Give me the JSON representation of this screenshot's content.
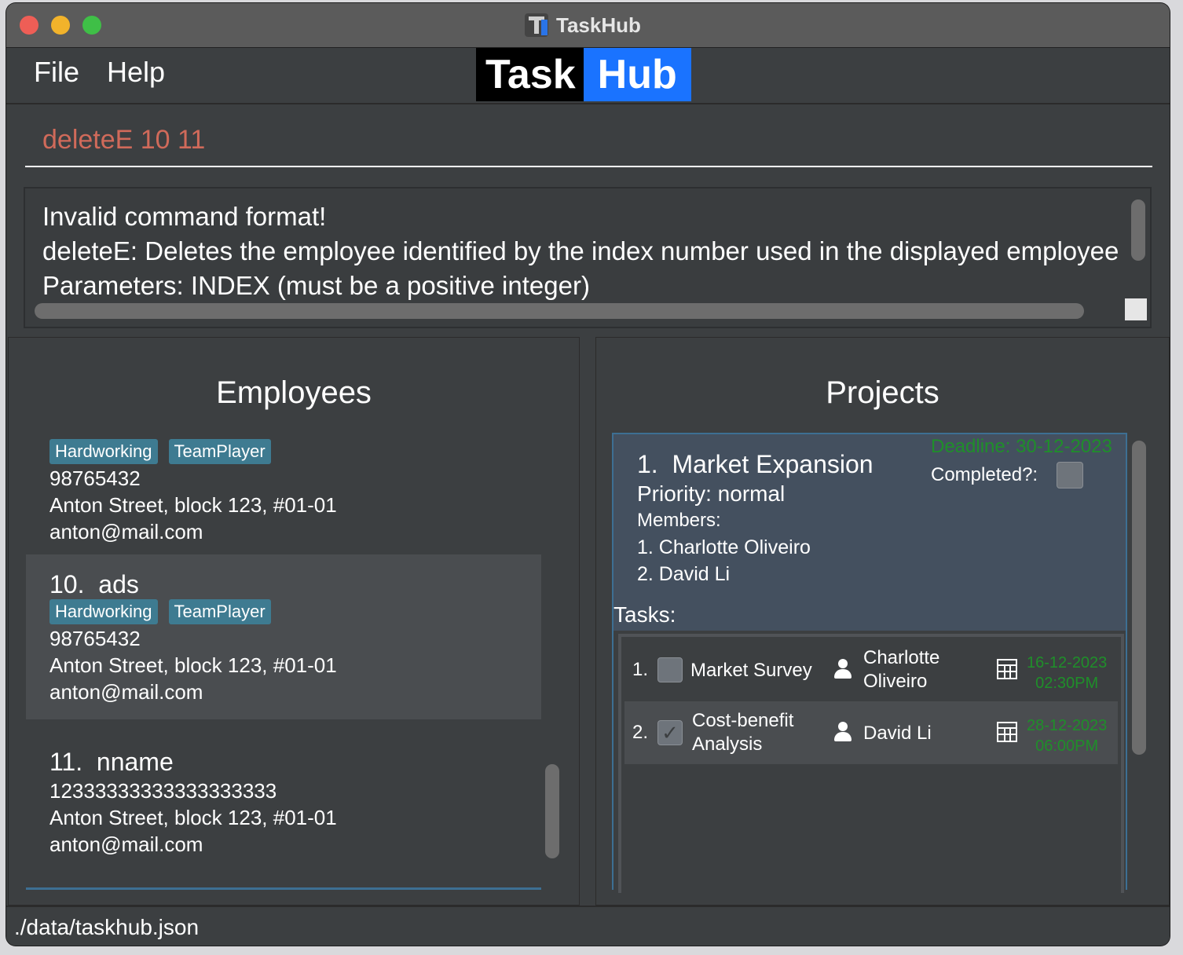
{
  "window": {
    "title": "TaskHub"
  },
  "menu": {
    "file": "File",
    "help": "Help"
  },
  "logo": {
    "part1": "Task",
    "part2": "Hub"
  },
  "command": {
    "value": "deleteE 10 11"
  },
  "result": {
    "line1": "Invalid command format!",
    "line2": "deleteE: Deletes the employee identified by the index number used in the displayed employee lis",
    "line3": "Parameters: INDEX (must be a positive integer)"
  },
  "employees": {
    "title": "Employees",
    "cards": [
      {
        "tags": [
          "Hardworking",
          "TeamPlayer"
        ],
        "phone": "98765432",
        "address": "Anton Street, block 123, #01-01",
        "email": "anton@mail.com"
      },
      {
        "index": "10.",
        "name": "ads",
        "tags": [
          "Hardworking",
          "TeamPlayer"
        ],
        "phone": "98765432",
        "address": "Anton Street, block 123, #01-01",
        "email": "anton@mail.com"
      },
      {
        "index": "11.",
        "name": "nname",
        "phone": "12333333333333333333",
        "address": "Anton Street, block 123, #01-01",
        "email": "anton@mail.com"
      }
    ]
  },
  "projects": {
    "title": "Projects",
    "card": {
      "index": "1.",
      "name": "Market Expansion",
      "priority": "Priority: normal",
      "members_label": "Members:",
      "members": [
        "1. Charlotte Oliveiro",
        "2. David Li"
      ],
      "deadline": "Deadline: 30-12-2023",
      "completed_label": "Completed?:",
      "tasks_label": "Tasks:",
      "tasks": [
        {
          "num": "1.",
          "name1": "Market Survey",
          "name2": "",
          "assignee1": "Charlotte",
          "assignee2": "Oliveiro",
          "date": "16-12-2023",
          "time": "02:30PM",
          "done": false
        },
        {
          "num": "2.",
          "name1": "Cost-benefit",
          "name2": "Analysis",
          "assignee1": "David Li",
          "assignee2": "",
          "date": "28-12-2023",
          "time": "06:00PM",
          "done": true
        }
      ]
    }
  },
  "status": {
    "path": "./data/taskhub.json"
  },
  "colors": {
    "accent": "#1a73ff",
    "command_text": "#d06a5a",
    "deadline": "#1f8f2a",
    "tag_bg": "#3e7b91"
  },
  "icons": {
    "assignee": "person-icon",
    "due": "calendar-icon",
    "done": "checkmark-icon"
  }
}
